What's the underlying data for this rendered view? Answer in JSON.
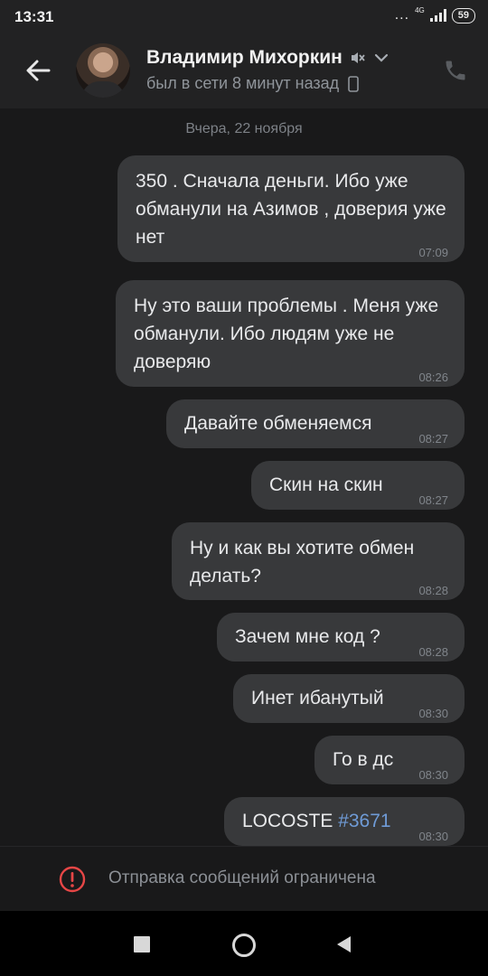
{
  "status_bar": {
    "time": "13:31",
    "dots": "...",
    "network": "4G",
    "battery": "59"
  },
  "header": {
    "name": "Владимир Михоркин",
    "last_seen": "был в сети 8 минут назад",
    "icons": {
      "back": "back-arrow-icon",
      "mute": "muted-speaker-icon",
      "expand": "chevron-down-icon",
      "device": "mobile-phone-icon",
      "call": "phone-call-icon"
    }
  },
  "chat": {
    "date_separator": "Вчера, 22 ноября",
    "messages": [
      {
        "text": "350 . Сначала деньги. Ибо уже обманули на Азимов , доверия уже нет",
        "time": "07:09"
      },
      {
        "text": "Ну это ваши проблемы . Меня уже обманули. Ибо людям уже не доверяю",
        "time": "08:26"
      },
      {
        "text": "Давайте обменяемся",
        "time": "08:27"
      },
      {
        "text": "Скин на скин",
        "time": "08:27"
      },
      {
        "text": "Ну и как вы хотите обмен делать?",
        "time": "08:28"
      },
      {
        "text": "Зачем мне код ?",
        "time": "08:28"
      },
      {
        "text": "Инет ибанутый",
        "time": "08:30"
      },
      {
        "text": "Го в дс",
        "time": "08:30"
      },
      {
        "text_prefix": "LOCOSTE ",
        "hashtag": "#3671",
        "time": "08:30"
      }
    ]
  },
  "footer": {
    "restriction_text": "Отправка сообщений ограничена",
    "icon": "warning-icon"
  },
  "colors": {
    "background": "#19191a",
    "bubble": "#38393b",
    "accent_link": "#6f9bd6",
    "warning": "#e64646"
  }
}
